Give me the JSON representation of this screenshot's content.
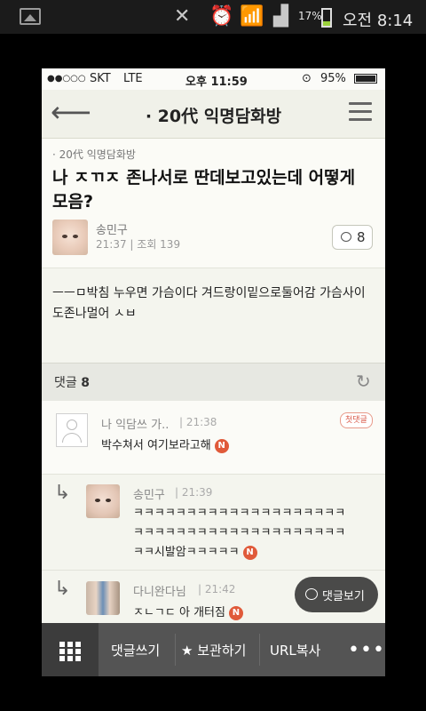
{
  "android_status": {
    "battery": "17%",
    "time": "오전 8:14"
  },
  "ios_status": {
    "signal": "●●○○○",
    "carrier": "SKT",
    "network": "LTE",
    "time": "오후 11:59",
    "battery": "95%"
  },
  "nav": {
    "back_icon": "arrow-left-icon",
    "title": "· 20代 익명담화방",
    "menu_icon": "hamburger-icon"
  },
  "post": {
    "board": "· 20代 익명담화방",
    "title": "나 ㅈㄲㅈ 존나서로 딴데보고있는데 어떻게 모음?",
    "author": "송민구",
    "time": "21:37",
    "views": "조회 139",
    "comment_count": "8",
    "body": "ㅡㅡㅁ박침 누우면 가슴이다 겨드랑이밑으로둘어감 가슴사이도존나멀어 ㅅㅂ"
  },
  "comments_header": {
    "label": "댓글",
    "count": "8"
  },
  "comments": [
    {
      "name": "나 익담쓰 가..",
      "time": "21:38",
      "badge": "첫댓글",
      "text": "박수쳐서 여기보라고해",
      "new": "N"
    },
    {
      "name": "송민구",
      "time": "21:39",
      "text_lines": [
        "ㅋㅋㅋㅋㅋㅋㅋㅋㅋㅋㅋㅋㅋㅋㅋㅋㅋㅋㅋㅋ",
        "ㅋㅋㅋㅋㅋㅋㅋㅋㅋㅋㅋㅋㅋㅋㅋㅋㅋㅋㅋㅋ",
        "ㅋㅋ시발암ㅋㅋㅋㅋㅋ"
      ],
      "new": "N"
    },
    {
      "name": "다니완다님",
      "time": "21:42",
      "text": "ㅈㄴㄱㄷ 아 개터짐",
      "new": "N"
    }
  ],
  "float_button": {
    "label": "댓글보기"
  },
  "bottom_bar": {
    "write": "댓글쓰기",
    "save": "보관하기",
    "url": "URL복사",
    "more": "•••"
  },
  "colors": {
    "accent_red": "#e05a3a",
    "bottom_bar": "#545454"
  }
}
